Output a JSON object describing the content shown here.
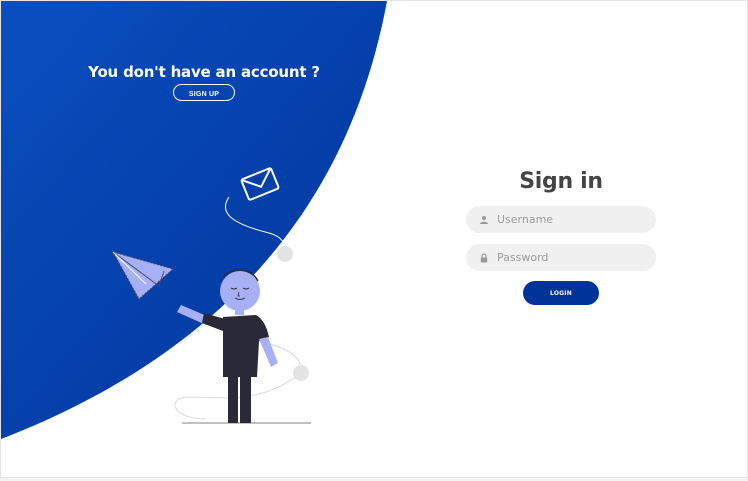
{
  "colors": {
    "accent": "#003399",
    "gradient_start": "#0849b8",
    "gradient_end": "#003399",
    "figure_skin": "#a8b0f5",
    "figure_dark": "#2a2937",
    "input_bg": "#f0f0f0",
    "title_text": "#444444"
  },
  "signup": {
    "prompt": "You don't have an account ?",
    "button_label": "SIGN UP"
  },
  "signin": {
    "title": "Sign in",
    "username": {
      "placeholder": "Username",
      "icon": "user-icon"
    },
    "password": {
      "placeholder": "Password",
      "icon": "lock-icon"
    },
    "login_label": "LOGIN"
  },
  "illustration": {
    "elements": [
      "envelope-icon",
      "paper-plane-icon",
      "person-figure"
    ]
  }
}
